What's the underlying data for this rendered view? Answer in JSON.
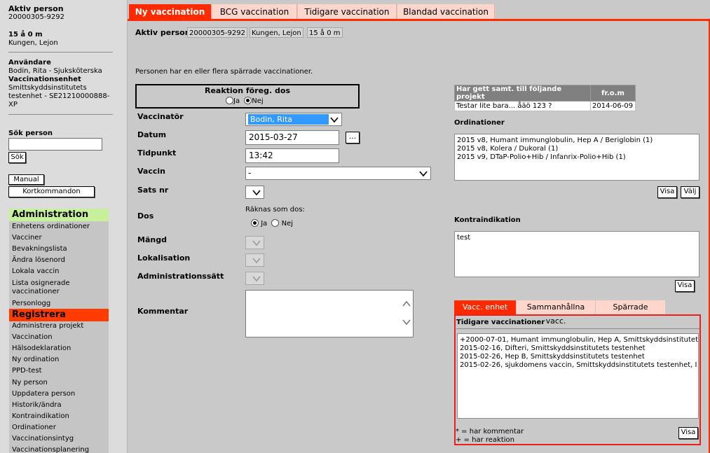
{
  "sidebar": {
    "active_person_label": "Aktiv person",
    "person_id": "20000305-9292",
    "age": "15 å 0 m",
    "name": "Kungen, Lejon",
    "user_label": "Användare",
    "user_value": "Bodin, Rita - Sjuksköterska",
    "unit_label": "Vaccinationsenhet",
    "unit_value_1": "Smittskyddsinstitutets",
    "unit_value_2": "testenhet - SE21210000888-",
    "unit_value_3": "XP",
    "search_label": "Sök person",
    "search_value": "",
    "search_button": "Sök",
    "manual_button": "Manual",
    "shortcuts_button": "Kortkommandon",
    "menu": {
      "admin_header": "Administration",
      "admin_items": [
        "Enhetens ordinationer",
        "Vacciner",
        "Bevakningslista",
        "Ändra lösenord",
        "Lokala vaccin",
        "Lista osignerade",
        "vaccinationer",
        "Personlogg"
      ],
      "register_header": "Registrera",
      "register_items": [
        "Administrera projekt",
        "Vaccination",
        "Hälsodeklaration",
        "Ny ordination",
        "PPD-test",
        "Ny person",
        "Uppdatera person",
        "Historik/ändra",
        "Kontraindikation",
        "Ordinationer",
        "Vaccinationsintyg",
        "Vaccinationsplanering"
      ]
    }
  },
  "tabs": [
    "Ny vaccination",
    "BCG vaccination",
    "Tidigare vaccination",
    "Blandad vaccination"
  ],
  "active_bar": {
    "label": "Aktiv person",
    "person_id": "20000305-9292",
    "name": "Kungen, Lejon",
    "age": "15 å 0 m"
  },
  "form": {
    "notice": "Personen har en eller flera spärrade vaccinationer.",
    "reaction_title": "Reaktion föreg. dos",
    "reaction_yes": "Ja",
    "reaction_no": "Nej",
    "vaccinator_label": "Vaccinatör",
    "vaccinator_value": "Bodin, Rita",
    "date_label": "Datum",
    "date_value": "2015-03-27",
    "date_button": "...",
    "time_label": "Tidpunkt",
    "time_value": "13:42",
    "vaccine_label": "Vaccin",
    "vaccine_value": "-",
    "batch_label": "Sats nr",
    "dose_label": "Dos",
    "counts_as_dose": "Räknas som dos:",
    "dose_yes": "Ja",
    "dose_no": "Nej",
    "amount_label": "Mängd",
    "location_label": "Lokalisation",
    "admin_method_label": "Administrationssätt",
    "comment_label": "Kommentar",
    "comment_value": ""
  },
  "projects": {
    "headers": [
      "Har gett samt. till följande projekt",
      "fr.o.m"
    ],
    "rows": [
      [
        "Testar lite bara... åäö 123 ?",
        "2014-06-09"
      ]
    ]
  },
  "orders": {
    "title": "Ordinationer",
    "items": [
      "2015 v8, Humant immunglobulin, Hep A / Beriglobin (1)",
      "2015 v8, Kolera / Dukoral (1)",
      "2015 v9, DTaP-Polio+Hib / Infanrix-Polio+Hib (1)"
    ],
    "show_button": "Visa",
    "select_button": "Välj"
  },
  "contraindication": {
    "title": "Kontraindikation",
    "value": "test",
    "show_button": "Visa"
  },
  "lower_tabs": [
    "Vacc. enhet",
    "Sammanhållna vacc.",
    "Spärrade"
  ],
  "previous": {
    "title": "Tidigare vaccinationer",
    "items": [
      "+2000-07-01, Humant immunglobulin, Hep A, Smittskyddsinstitutets",
      "2015-02-16, Difteri, Smittskyddsinstitutets testenhet",
      "2015-02-26, Hep B, Smittskyddsinstitutets testenhet",
      "2015-02-26, sjukdomens vaccin, Smittskyddsinstitutets testenhet, I"
    ],
    "legend_comment": "* = har kommentar",
    "legend_reaction": "+ = har reaktion",
    "show_button": "Visa"
  }
}
